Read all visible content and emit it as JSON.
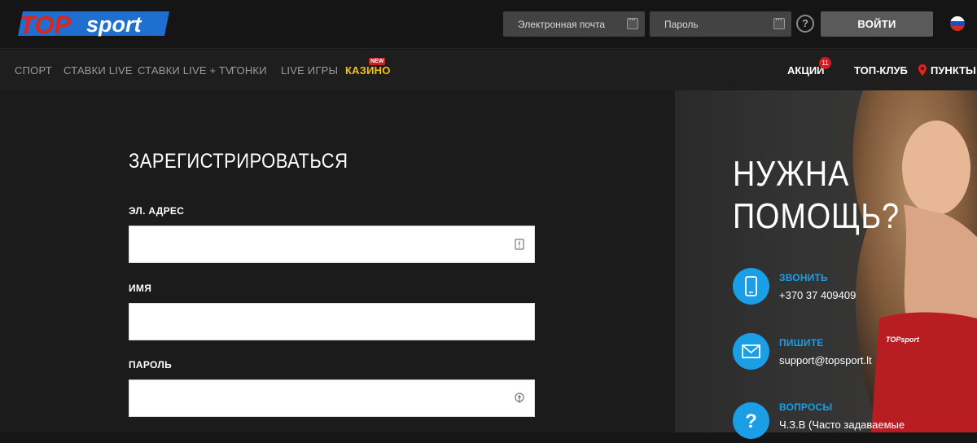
{
  "header": {
    "logo_text_top": "TOP",
    "logo_text_sport": "sport",
    "email_placeholder": "Электронная почта",
    "password_placeholder": "Пароль",
    "help_symbol": "?",
    "login_label": "ВОЙТИ",
    "language": "ru"
  },
  "nav": {
    "items": [
      "СПОРТ",
      "СТАВКИ LIVE",
      "СТАВКИ LIVE + TV",
      "ГОНКИ",
      "LIVE ИГРЫ",
      "КАЗИНО"
    ],
    "new_badge": "NEW",
    "promotions_label": "АКЦИИ",
    "promotions_count": "11",
    "top_club_label": "ТОП-КЛУБ",
    "points_label": "ПУНКТЫ"
  },
  "registration": {
    "title": "ЗАРЕГИСТРИРОВАТЬСЯ",
    "email_label": "ЭЛ. АДРЕС",
    "name_label": "ИМЯ",
    "password_label": "ПАРОЛЬ",
    "email_value": "",
    "name_value": "",
    "password_value": ""
  },
  "help": {
    "title_line1": "НУЖНА",
    "title_line2": "ПОМОЩЬ?",
    "call_label": "ЗВОНИТЬ",
    "call_value": "+370 37 409409",
    "write_label": "ПИШИТЕ",
    "write_value": "support@topsport.lt",
    "faq_label": "ВОПРОСЫ",
    "faq_value": "Ч.З.В (Часто задаваемые",
    "shirt_text": "TOPsport"
  },
  "colors": {
    "accent_blue": "#1a9ee5",
    "brand_red": "#d31b20",
    "casino_yellow": "#f5c400",
    "logo_blue": "#1e6fd0"
  }
}
